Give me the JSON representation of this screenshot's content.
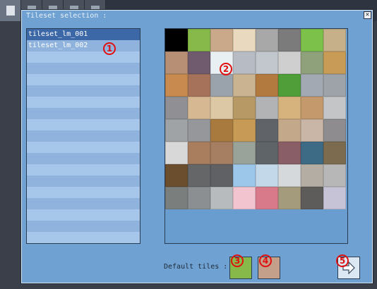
{
  "toolbar": {
    "buttons": [
      {
        "name": "new-map-button",
        "icon": "page-icon",
        "active": true
      },
      {
        "name": "tool-button-2",
        "icon": "tool-icon",
        "active": false
      },
      {
        "name": "tool-button-3",
        "icon": "tool-icon",
        "active": false
      },
      {
        "name": "tool-button-4",
        "icon": "tool-icon",
        "active": false
      },
      {
        "name": "tool-button-5",
        "icon": "tool-icon",
        "active": false
      }
    ]
  },
  "dialog": {
    "title": "Tileset selection :",
    "close_label": "✕"
  },
  "tileset_list": {
    "items": [
      "tileset_lm_001",
      "tileset_lm_002"
    ],
    "selected_index": 0
  },
  "annotations": [
    "1",
    "2",
    "3",
    "4",
    "5"
  ],
  "tiles": [
    "#000000",
    "#86b84a",
    "#c9a98a",
    "#e8d9bf",
    "#a8a8a8",
    "#7b7b7b",
    "#7cc24a",
    "#c5b08a",
    "#b68f74",
    "#6f5a6e",
    "#e9f0f4",
    "#b7bcc4",
    "#c1c7cc",
    "#cfcfcf",
    "#8fa17a",
    "#c89b57",
    "#c88a4e",
    "#a6735a",
    "#9aa2ab",
    "#c9b391",
    "#b27a3f",
    "#4f9e3a",
    "#a2a9b2",
    "#9ea3a9",
    "#8f8f94",
    "#d6b893",
    "#dcc8a4",
    "#b79966",
    "#b1b3b5",
    "#d6b27c",
    "#c49a6c",
    "#c4c5c6",
    "#9fa3a5",
    "#95979b",
    "#a97a3e",
    "#c79a56",
    "#606469",
    "#c4a88a",
    "#c9b6a6",
    "#8e8c8e",
    "#d8d8d8",
    "#a97e5e",
    "#a67f63",
    "#9aa39a",
    "#5e6468",
    "#8a5e66",
    "#3d6a84",
    "#7c6b4e",
    "#6b4e2e",
    "#646668",
    "#5f6165",
    "#9dc7ea",
    "#c3d8e8",
    "#d5d9dc",
    "#b4ada4",
    "#b7b7b7",
    "#7a7f7e",
    "#8b8f91",
    "#b7bbbd",
    "#f2c4cf",
    "#d87a8a",
    "#a49a7c",
    "#5e5c5a",
    "#c6c3d6"
  ],
  "default_tiles": {
    "label": "Default tiles :",
    "ground_color": "#86b84a",
    "wall_color": "#c4a08a"
  },
  "next_button": {
    "icon": "arrow-right-icon"
  }
}
